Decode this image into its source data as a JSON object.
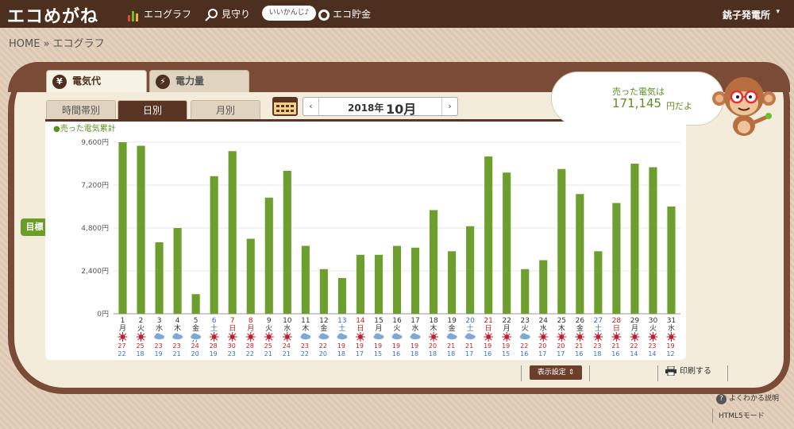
{
  "app": {
    "logo": "エコめがね"
  },
  "nav": [
    {
      "label": "エコグラフ",
      "icon": "bar-chart-icon"
    },
    {
      "label": "見守り",
      "icon": "magnifier-icon"
    },
    {
      "label": "エコ貯金",
      "icon": "coin-icon"
    }
  ],
  "mood_bubble": "いいかんじ♪",
  "plant": {
    "label": "銚子発電所",
    "caret": "▾"
  },
  "breadcrumb": "HOME » エコグラフ",
  "main_tabs": [
    {
      "label": "電気代",
      "icon_glyph": "¥",
      "active": true
    },
    {
      "label": "電力量",
      "icon_glyph": "⚡",
      "active": false
    }
  ],
  "sub_tabs": [
    {
      "label": "時間帯別",
      "active": false
    },
    {
      "label": "日別",
      "active": true
    },
    {
      "label": "月別",
      "active": false
    }
  ],
  "date": {
    "prev": "‹",
    "year": "2018年",
    "month": "10月",
    "next": "›"
  },
  "bubble": {
    "line1": "売った電気は",
    "amount": "171,145",
    "suffix": "円だよ"
  },
  "mokuhyo_button": "目標 ⇕",
  "colors": {
    "bar": "#6c9f2e",
    "header": "#4d2f1f",
    "panel_border": "#7a4c37",
    "saturday": "#3a6fc4",
    "sunday": "#c02020"
  },
  "chart_data": {
    "type": "bar",
    "legend": "●売った電気累計",
    "ylim": [
      0,
      9600
    ],
    "yticks": [
      "0円",
      "2,400円",
      "4,800円",
      "7,200円",
      "9,600円"
    ],
    "ytick_values": [
      0,
      2400,
      4800,
      7200,
      9600
    ],
    "days": [
      "1",
      "2",
      "3",
      "4",
      "5",
      "6",
      "7",
      "8",
      "9",
      "10",
      "11",
      "12",
      "13",
      "14",
      "15",
      "16",
      "17",
      "18",
      "19",
      "20",
      "21",
      "22",
      "23",
      "24",
      "25",
      "26",
      "27",
      "28",
      "29",
      "30",
      "31"
    ],
    "weekdays": [
      "月",
      "火",
      "水",
      "木",
      "金",
      "土",
      "日",
      "月",
      "火",
      "水",
      "木",
      "金",
      "土",
      "日",
      "月",
      "火",
      "水",
      "木",
      "金",
      "土",
      "日",
      "月",
      "火",
      "水",
      "木",
      "金",
      "土",
      "日",
      "月",
      "火",
      "水"
    ],
    "day_types": [
      "w",
      "w",
      "w",
      "w",
      "w",
      "sat",
      "sun",
      "hol",
      "w",
      "w",
      "w",
      "w",
      "sat",
      "sun",
      "w",
      "w",
      "w",
      "w",
      "w",
      "sat",
      "sun",
      "w",
      "w",
      "w",
      "w",
      "w",
      "sat",
      "sun",
      "w",
      "w",
      "w"
    ],
    "values": [
      9600,
      9400,
      4000,
      4800,
      1100,
      7700,
      9100,
      4200,
      6500,
      8000,
      3800,
      2500,
      2000,
      3300,
      3300,
      3800,
      3700,
      5800,
      3500,
      4900,
      8800,
      7900,
      2500,
      3000,
      8100,
      6700,
      3500,
      6200,
      8400,
      8200,
      6000
    ],
    "weather": [
      "sun",
      "sun",
      "cloud",
      "cloud",
      "cloud-rain",
      "sun",
      "sun",
      "sun",
      "sun",
      "sun",
      "cloud",
      "cloud",
      "cloud",
      "sun",
      "cloud",
      "cloud",
      "cloud",
      "sun",
      "cloud",
      "cloud",
      "sun",
      "sun",
      "cloud",
      "sun",
      "sun",
      "sun",
      "sun",
      "sun",
      "sun",
      "sun",
      "sun"
    ],
    "temp_high": [
      27,
      25,
      23,
      23,
      24,
      28,
      30,
      28,
      25,
      24,
      23,
      22,
      19,
      19,
      19,
      19,
      19,
      20,
      21,
      21,
      19,
      19,
      22,
      20,
      20,
      21,
      23,
      21,
      22,
      23,
      19
    ],
    "temp_low": [
      22,
      18,
      19,
      21,
      20,
      19,
      23,
      22,
      21,
      21,
      22,
      20,
      18,
      17,
      15,
      16,
      18,
      18,
      18,
      17,
      16,
      15,
      16,
      17,
      17,
      16,
      18,
      16,
      14,
      14,
      12
    ]
  },
  "footer": {
    "display_settings": "表示設定 ⇕",
    "print": "印刷する",
    "help": "よくわかる説明",
    "help_glyph": "?",
    "html5": "HTML5モード"
  }
}
